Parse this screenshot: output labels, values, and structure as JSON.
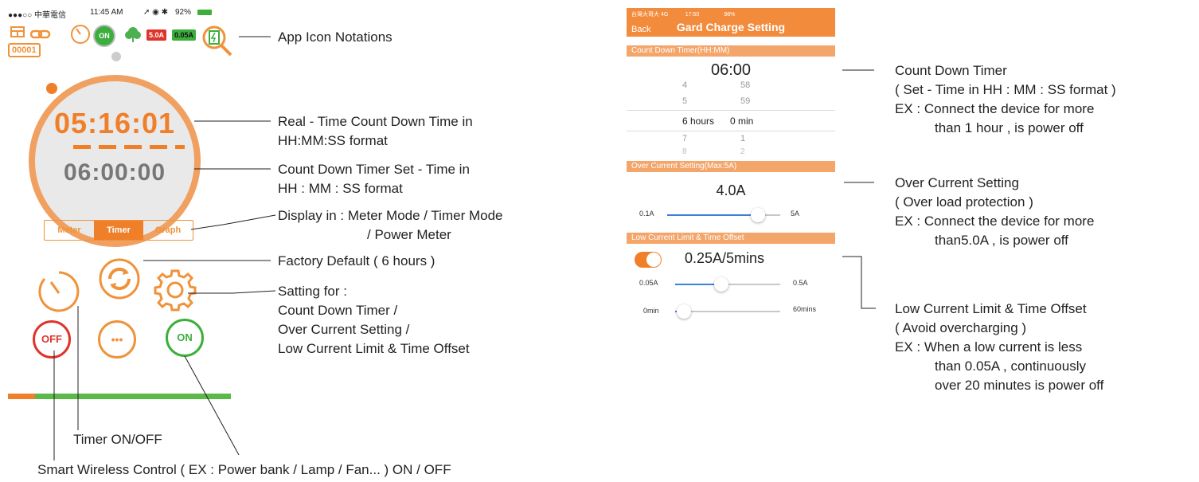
{
  "left_phone": {
    "status_bar": {
      "carrier": "●●●○○ 中華電信",
      "time": "11:45 AM",
      "battery": "92%"
    },
    "icons": {
      "on_badge": "ON",
      "current_high": "5.0A",
      "current_low": "0.05A",
      "device_id": "00001"
    },
    "clock": {
      "countdown": "05:16:01",
      "set_time": "06:00:00"
    },
    "mode_tabs": [
      {
        "label": "Meter"
      },
      {
        "label": "Timer"
      },
      {
        "label": "Graph"
      }
    ],
    "buttons": {
      "off": "OFF",
      "more": "•••",
      "on": "ON"
    }
  },
  "right_phone": {
    "status_bar": {
      "carrier": "台灣大哥大 4G",
      "time": "17:50",
      "battery": "98%"
    },
    "back": "Back",
    "title": "Gard Charge Setting",
    "timer_section": "Count Down Timer(HH:MM)",
    "timer_value": "06:00",
    "picker": {
      "hours": [
        "4",
        "5",
        "6 hours",
        "7",
        "8"
      ],
      "minutes": [
        "58",
        "59",
        "0 min",
        "1",
        "2"
      ]
    },
    "over_current_section": "Over Current Setting(Max:5A)",
    "over_current_value": "4.0A",
    "over_current_slider": {
      "min": "0.1A",
      "max": "5A",
      "level": 0.8
    },
    "low_current_section": "Low Current Limit & Time Offset",
    "low_current_value": "0.25A/5mins",
    "low_current_slider": {
      "min": "0.05A",
      "max": "0.5A",
      "level": 0.44
    },
    "time_offset_slider": {
      "min": "0min",
      "max": "60mins",
      "level": 0.08
    }
  },
  "annotations_left": {
    "app_icons": "App Icon Notations",
    "realtime": [
      "Real - Time Count Down Time in",
      "HH:MM:SS format"
    ],
    "set_time": [
      "Count Down Timer Set - Time in",
      "HH : MM : SS format"
    ],
    "display": [
      "Display in : Meter Mode / Timer Mode",
      "/ Power Meter"
    ],
    "factory": "Factory Default  ( 6 hours )",
    "setting": [
      "Satting for :",
      "Count Down Timer /",
      "Over Current Setting /",
      "Low Current Limit & Time Offset"
    ],
    "timer_onoff": "Timer ON/OFF",
    "smart": "Smart Wireless Control ( EX : Power bank / Lamp / Fan... ) ON / OFF"
  },
  "annotations_right": {
    "countdown": [
      "Count Down Timer",
      "( Set - Time in HH : MM : SS format )",
      "EX : Connect the device for more",
      "than 1 hour ,  is power off"
    ],
    "overcurrent": [
      "Over Current Setting",
      "( Over load protection )",
      "EX : Connect the device for more",
      "than5.0A , is power off"
    ],
    "lowcurrent": [
      "Low Current Limit & Time Offset",
      "( Avoid overcharging )",
      "EX : When a low current is less",
      "than 0.05A , continuously",
      "over 20 minutes is power off"
    ]
  },
  "colors": {
    "accent": "#f07f2a",
    "green": "#3cae3c",
    "red": "#e0332a"
  }
}
